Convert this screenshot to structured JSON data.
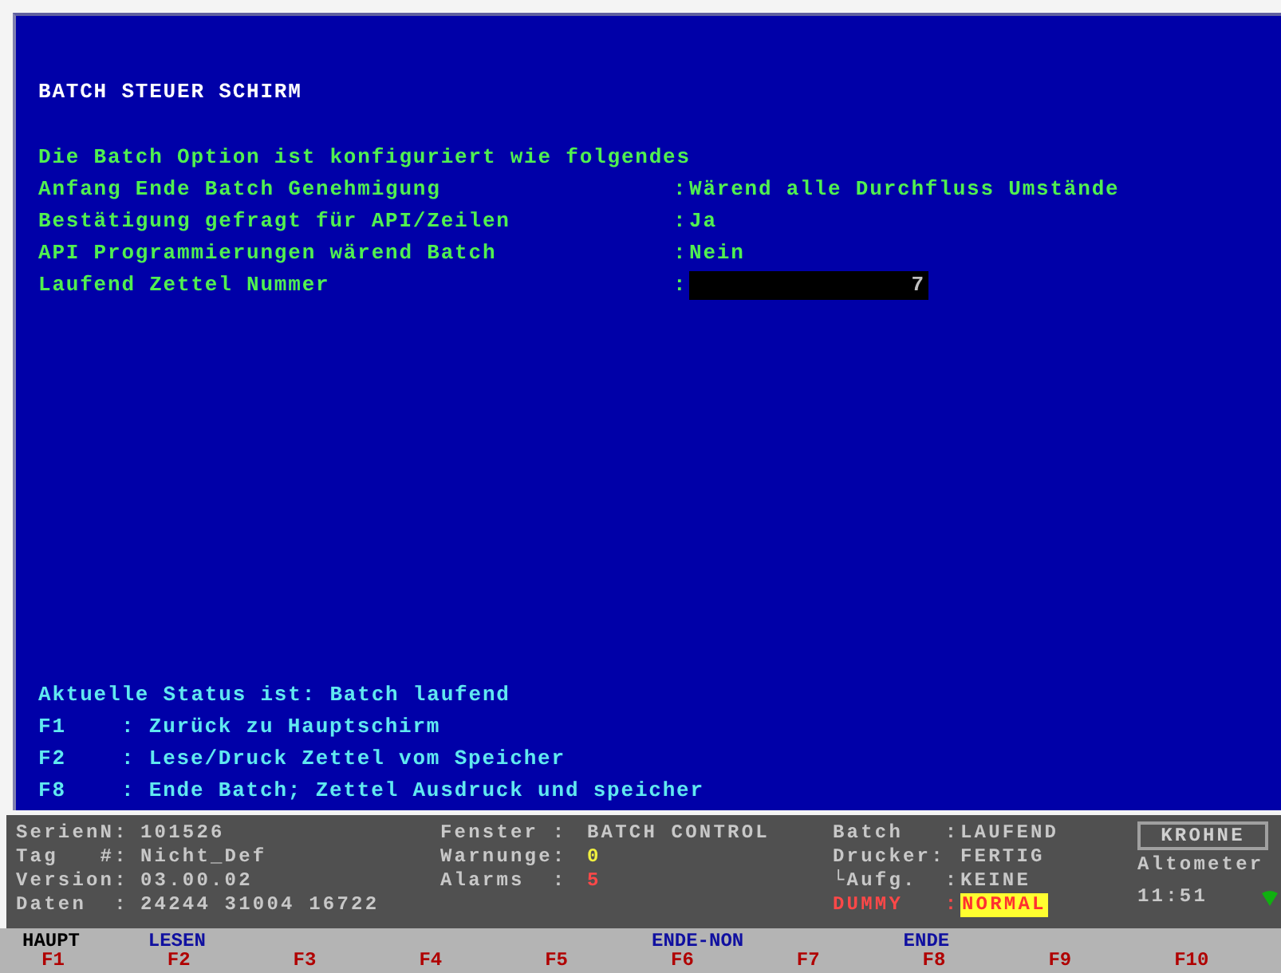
{
  "screen": {
    "title": "BATCH STEUER SCHIRM",
    "intro": "Die Batch Option ist konfiguriert wie folgendes",
    "settings": [
      {
        "kind": "text",
        "label": "Anfang Ende Batch Genehmigung",
        "separator": ":",
        "value": "Wärend alle Durchfluss Umstände"
      },
      {
        "kind": "text",
        "label": "Bestätigung gefragt für API/Zeilen",
        "separator": ":",
        "value": "Ja"
      },
      {
        "kind": "text",
        "label": "API Programmierungen wärend Batch",
        "separator": ":",
        "value": "Nein"
      },
      {
        "kind": "input",
        "label": "Laufend Zettel Nummer",
        "separator": ":",
        "value": "7"
      }
    ],
    "status_line": "Aktuelle Status ist: Batch laufend",
    "key_help": [
      {
        "key": "F1",
        "text": ": Zurück zu Hauptschirm"
      },
      {
        "key": "F2",
        "text": ": Lese/Druck Zettel vom Speicher"
      },
      {
        "key": "F8",
        "text": ": Ende Batch; Zettel Ausdruck und speicher"
      }
    ]
  },
  "status_bar": {
    "columns": [
      [
        {
          "kind": "plain",
          "label": "SerienN:",
          "value": "101526"
        },
        {
          "kind": "plain",
          "label": "Tag   #:",
          "value": "Nicht_Def"
        },
        {
          "kind": "plain",
          "label": "Version:",
          "value": "03.00.02"
        },
        {
          "kind": "plain",
          "label": "Daten  :",
          "value": "24244 31004 16722"
        }
      ],
      [
        {
          "kind": "plain",
          "label": "Fenster :",
          "value": "BATCH CONTROL"
        },
        {
          "kind": "warning",
          "label": "Warnunge:",
          "value": "0"
        },
        {
          "kind": "alarm",
          "label": "Alarms  :",
          "value": "5"
        }
      ],
      [
        {
          "kind": "plain",
          "label": "Batch   :",
          "value": "LAUFEND"
        },
        {
          "kind": "plain",
          "label": "Drucker:",
          "value": "FERTIG"
        },
        {
          "kind": "plain",
          "label": "└Aufg.  :",
          "value": "KEINE"
        },
        {
          "kind": "alert",
          "label": "DUMMY   :",
          "value": "NORMAL"
        }
      ]
    ],
    "brand": "KROHNE",
    "product": "Altometer",
    "time": "11:51"
  },
  "function_keys": [
    {
      "key": "F1",
      "label": "HAUPT",
      "selected": true
    },
    {
      "key": "F2",
      "label": "LESEN",
      "selected": false
    },
    {
      "key": "F3"
    },
    {
      "key": "F4"
    },
    {
      "key": "F5"
    },
    {
      "key": "F6",
      "label": "ENDE-NON",
      "selected": false
    },
    {
      "key": "F7"
    },
    {
      "key": "F8",
      "label": "ENDE",
      "selected": false
    },
    {
      "key": "F9"
    },
    {
      "key": "F10"
    }
  ]
}
